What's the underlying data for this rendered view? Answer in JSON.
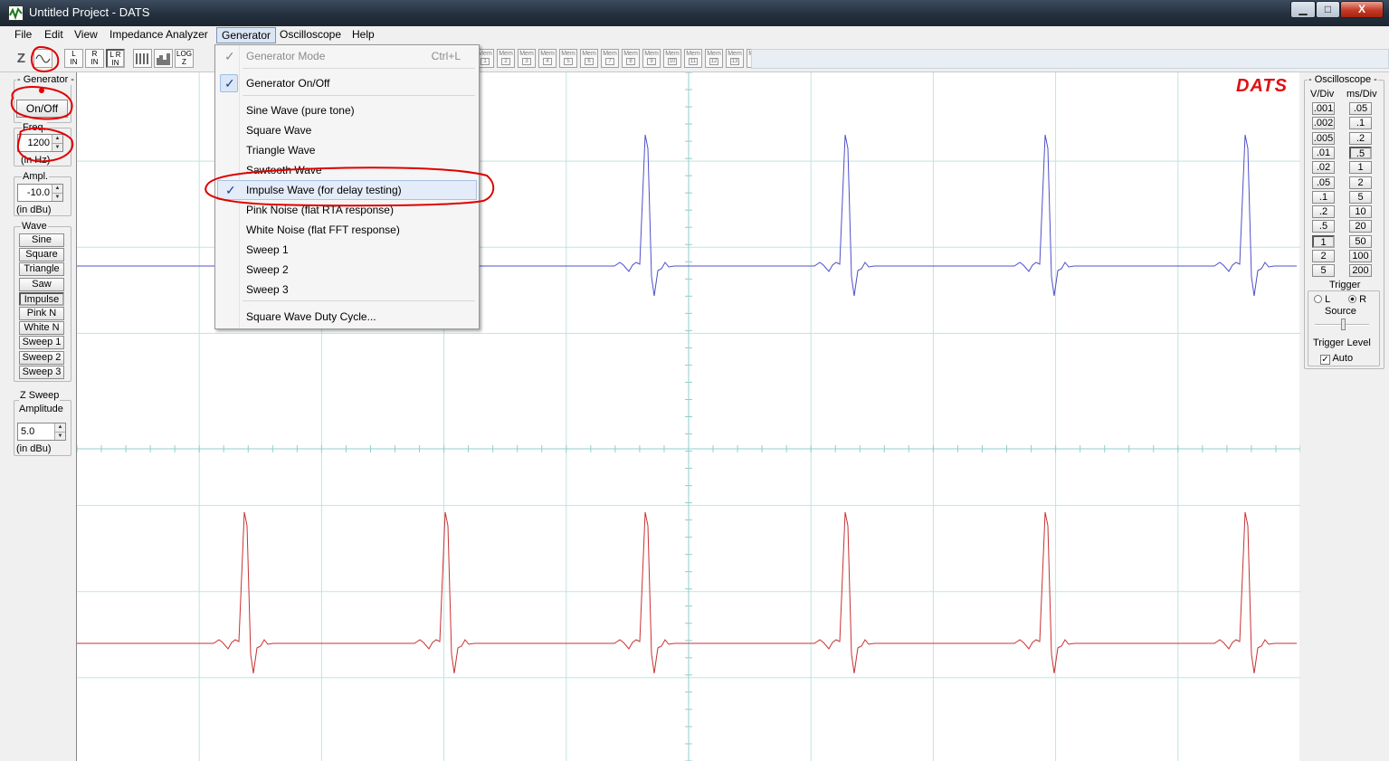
{
  "window": {
    "title": "Untitled Project - DATS",
    "controls": {
      "minimize": "▁",
      "maximize": "□",
      "close": "X"
    }
  },
  "menubar": {
    "items": [
      "File",
      "Edit",
      "View",
      "Impedance Analyzer",
      "Generator",
      "Oscilloscope",
      "Help"
    ],
    "open": "Generator"
  },
  "toolbar": {
    "buttons": [
      {
        "icon": "impedance-z-icon"
      },
      {
        "icon": "sine-wave-icon"
      },
      {
        "top": "L",
        "bottom": "IN"
      },
      {
        "top": "R",
        "bottom": "IN"
      },
      {
        "top": "L R",
        "bottom": "IN"
      },
      {
        "icon": "bars-icon"
      },
      {
        "icon": "spectrum-icon"
      },
      {
        "top": "LOG",
        "bottom": "Z"
      }
    ],
    "mem_label": "Mem",
    "mem_numbers": [
      "1",
      "2",
      "3",
      "4",
      "5",
      "6",
      "7",
      "8",
      "9",
      "10",
      "11",
      "12",
      "13",
      "14",
      "15",
      "16",
      "17",
      "18",
      "19",
      "20"
    ]
  },
  "generator_menu": {
    "items": [
      {
        "label": "Generator Mode",
        "shortcut": "Ctrl+L",
        "checked": true,
        "disabled": true
      },
      {
        "label": "Generator On/Off",
        "checked": true,
        "checkbox": true
      },
      {
        "label": "Sine Wave (pure tone)"
      },
      {
        "label": "Square Wave"
      },
      {
        "label": "Triangle Wave"
      },
      {
        "label": "Sawtooth Wave"
      },
      {
        "label": "Impulse Wave (for delay testing)",
        "checked": true,
        "highlighted": true
      },
      {
        "label": "Pink Noise (flat RTA response)"
      },
      {
        "label": "White Noise (flat FFT response)"
      },
      {
        "label": "Sweep 1"
      },
      {
        "label": "Sweep 2"
      },
      {
        "label": "Sweep 3"
      },
      {
        "label": "Square Wave Duty Cycle..."
      }
    ]
  },
  "left_panel": {
    "generator": {
      "title": "- Generator -",
      "on_off": "On/Off"
    },
    "freq": {
      "title": "Freq.",
      "value": "1200",
      "unit": "(in Hz)"
    },
    "ampl": {
      "title": "Ampl.",
      "value": "-10.0",
      "unit": "(in dBu)"
    },
    "wave": {
      "title": "Wave",
      "buttons": [
        "Sine",
        "Square",
        "Triangle",
        "Saw",
        "Impulse",
        "Pink N",
        "White N",
        "Sweep 1",
        "Sweep 2",
        "Sweep 3"
      ],
      "selected": "Impulse"
    },
    "zsweep": {
      "title": "Z Sweep",
      "subtitle": "Amplitude",
      "value": "5.0",
      "unit": "(in dBu)"
    }
  },
  "plot": {
    "logo": "DATS",
    "colors": {
      "left": "#5050c8",
      "right": "#c83232",
      "grid": "#bfe3e3",
      "axis": "#8fcfcf"
    }
  },
  "right_panel": {
    "title": "- Oscilloscope -",
    "vdiv_label": "V/Div",
    "msdiv_label": "ms/Div",
    "vdiv": [
      ".001",
      ".002",
      ".005",
      ".01",
      ".02",
      ".05",
      ".1",
      ".2",
      ".5",
      "1",
      "2",
      "5"
    ],
    "msdiv": [
      ".05",
      ".1",
      ".2",
      ".5",
      "1",
      "2",
      "5",
      "10",
      "20",
      "50",
      "100",
      "200"
    ],
    "vdiv_selected": "1",
    "msdiv_selected": ".5",
    "trigger": {
      "title": "Trigger",
      "left": "L",
      "right": "R",
      "source_label": "Source",
      "selected": "R",
      "level_label": "Trigger Level",
      "auto_label": "Auto",
      "auto_checked": true
    }
  },
  "annotation_color": "#e00000"
}
